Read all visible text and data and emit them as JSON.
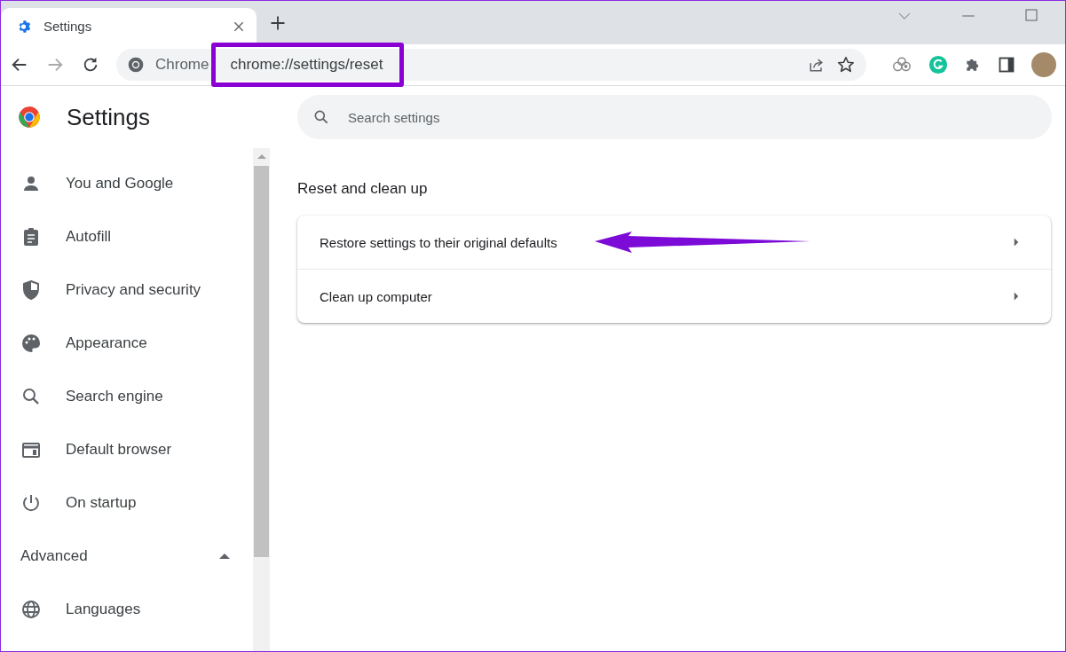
{
  "tabs": [
    {
      "label": "Settings",
      "selected": true
    }
  ],
  "address": {
    "site_label": "Chrome",
    "url": "chrome://settings/reset",
    "highlighted": true
  },
  "page": {
    "title": "Settings",
    "search": {
      "placeholder": "Search settings"
    }
  },
  "sidebar": {
    "items": [
      {
        "label": "You and Google",
        "kind": "item"
      },
      {
        "label": "Autofill",
        "kind": "item"
      },
      {
        "label": "Privacy and security",
        "kind": "item"
      },
      {
        "label": "Appearance",
        "kind": "item"
      },
      {
        "label": "Search engine",
        "kind": "item"
      },
      {
        "label": "Default browser",
        "kind": "item"
      },
      {
        "label": "On startup",
        "kind": "item"
      },
      {
        "label": "Advanced",
        "kind": "section",
        "expanded": true
      },
      {
        "label": "Languages",
        "kind": "item"
      }
    ]
  },
  "section": {
    "title": "Reset and clean up",
    "rows": [
      {
        "label": "Restore settings to their original defaults",
        "pointed": true
      },
      {
        "label": "Clean up computer",
        "pointed": false
      }
    ]
  }
}
